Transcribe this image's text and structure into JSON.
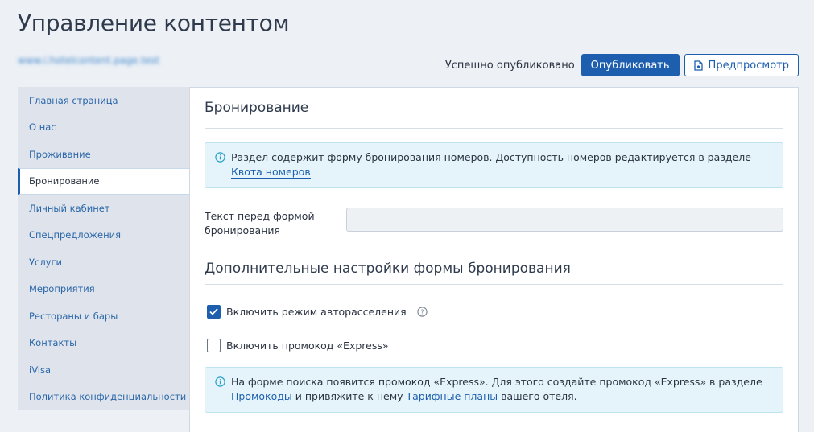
{
  "header": {
    "title": "Управление контентом",
    "site_link": "www.i.hotelcontent.page.test"
  },
  "top_actions": {
    "status": "Успешно опубликовано",
    "publish_label": "Опубликовать",
    "preview_label": "Предпросмотр"
  },
  "sidebar": {
    "items": [
      {
        "label": "Главная страница"
      },
      {
        "label": "О нас"
      },
      {
        "label": "Проживание"
      },
      {
        "label": "Бронирование",
        "active": true
      },
      {
        "label": "Личный кабинет"
      },
      {
        "label": "Спецпредложения"
      },
      {
        "label": "Услуги"
      },
      {
        "label": "Мероприятия"
      },
      {
        "label": "Рестораны и бары"
      },
      {
        "label": "Контакты"
      },
      {
        "label": "iVisa"
      },
      {
        "label": "Политика конфиденциальности"
      }
    ]
  },
  "main": {
    "section_title": "Бронирование",
    "info1": {
      "text": "Раздел содержит форму бронирования номеров. Доступность номеров редактируется в разделе",
      "link": "Квота номеров"
    },
    "form": {
      "label": "Текст перед формой бронирования",
      "value": "",
      "placeholder": ""
    },
    "additional_title": "Дополнительные настройки формы бронирования",
    "checkboxes": [
      {
        "label": "Включить режим авторасселения",
        "checked": true
      },
      {
        "label": "Включить промокод «Express»",
        "checked": false
      }
    ],
    "info2": {
      "text_before": "На форме поиска появится промокод «Express». Для этого создайте промокод «Express» в разделе",
      "link1": "Промокоды",
      "text_middle": "и привяжите к нему",
      "link2": "Тарифные планы",
      "text_after": "вашего отеля."
    }
  },
  "colors": {
    "accent": "#1d5fae",
    "background": "#edf1f6",
    "info_bg": "#e5f4fb",
    "info_icon": "#2aa3cc"
  },
  "icons": {
    "preview": "document-eye-icon",
    "info": "info-circle-icon",
    "help": "question-circle-icon",
    "check": "checkmark-icon"
  }
}
